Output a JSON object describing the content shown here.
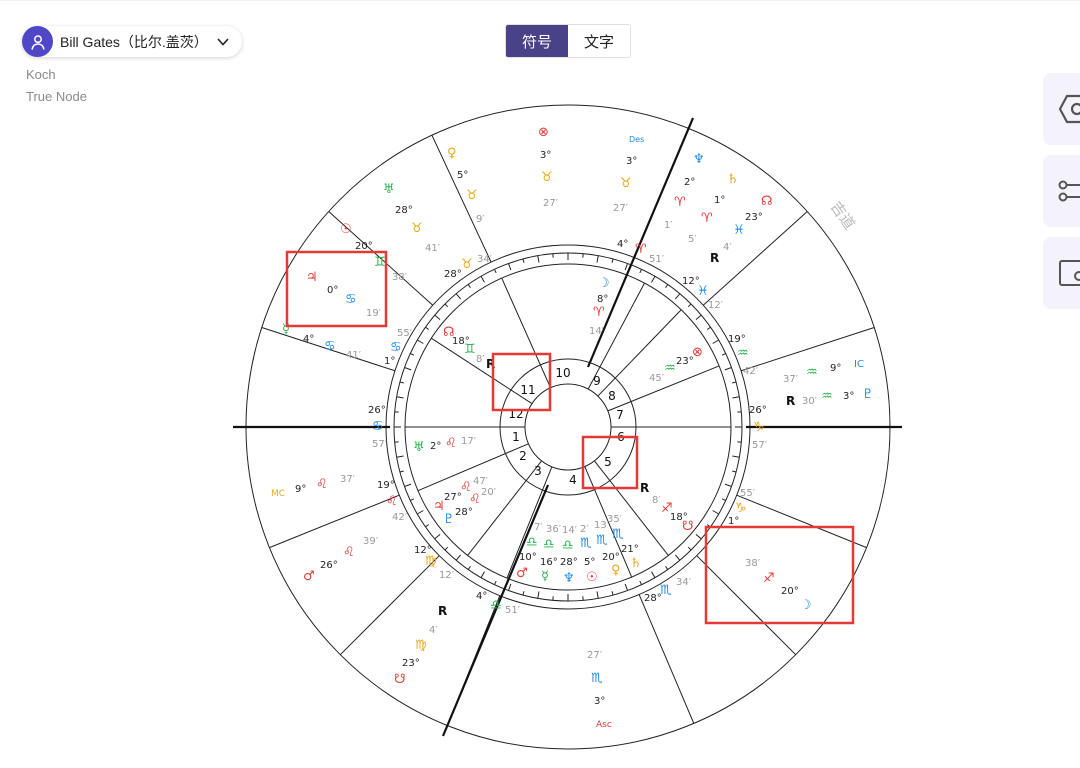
{
  "user": {
    "name": "Bill Gates（比尔.盖茨）"
  },
  "settings": {
    "house_system": "Koch",
    "node_type": "True Node"
  },
  "view_toggle": {
    "symbols_label": "符号",
    "text_label": "文字",
    "active": "symbols"
  },
  "chart": {
    "watermark": "吉道",
    "houses": [
      "1",
      "2",
      "3",
      "4",
      "5",
      "6",
      "7",
      "8",
      "9",
      "10",
      "11",
      "12"
    ],
    "angles": {
      "ic": "IC",
      "mc": "MC",
      "des": "Des",
      "asc": "Asc"
    },
    "retrograde_mark": "R",
    "inner_cusps": [
      {
        "deg": "4°",
        "sign": "♈",
        "min": "51′"
      },
      {
        "deg": "12°",
        "sign": "♓",
        "min": "12′"
      },
      {
        "deg": "19°",
        "sign": "♒",
        "min": "42′"
      },
      {
        "deg": "26°",
        "sign": "♑",
        "min": "57′"
      },
      {
        "deg": "1°",
        "sign": "♑",
        "min": "55′"
      },
      {
        "deg": "28°",
        "sign": "♏",
        "min": "34′"
      },
      {
        "deg": "4°",
        "sign": "♎",
        "min": "51′"
      },
      {
        "deg": "12°",
        "sign": "♍",
        "min": "12′"
      },
      {
        "deg": "19°",
        "sign": "♌",
        "min": "42′"
      },
      {
        "deg": "26°",
        "sign": "♋",
        "min": "57′"
      },
      {
        "deg": "1°",
        "sign": "♋",
        "min": "55′"
      },
      {
        "deg": "28°",
        "sign": "♉",
        "min": "34′"
      }
    ],
    "inner_planets": [
      {
        "name": "moon",
        "glyph": "☽",
        "deg": "8°",
        "sign": "♈",
        "min": "14′"
      },
      {
        "name": "part-of-fortune",
        "glyph": "⊗",
        "deg": "23°",
        "sign": "♒",
        "min": "45′"
      },
      {
        "name": "south-node",
        "glyph": "☋",
        "deg": "18°",
        "sign": "♐",
        "min": "8′",
        "retro": "R"
      },
      {
        "name": "north-node",
        "glyph": "☊",
        "deg": "18°",
        "sign": "♊",
        "min": "8′",
        "retro": "R"
      },
      {
        "name": "uranus",
        "glyph": "♅",
        "deg": "2°",
        "sign": "♌",
        "min": "17′"
      },
      {
        "name": "lilith",
        "glyph": "⚸",
        "deg": "27°",
        "sign": "♌",
        "min": "47′"
      },
      {
        "name": "jupiter",
        "glyph": "♃",
        "deg": "28°",
        "sign": "♌",
        "min": "20′"
      },
      {
        "name": "pluto",
        "glyph": "♇",
        "deg": "28°",
        "sign": "♌",
        "min": "20′"
      },
      {
        "name": "mars",
        "glyph": "♂",
        "deg": "10°",
        "sign": "♎",
        "min": "7′"
      },
      {
        "name": "mercury",
        "glyph": "☿",
        "deg": "16°",
        "sign": "♎",
        "min": "36′"
      },
      {
        "name": "neptune",
        "glyph": "♆",
        "deg": "28°",
        "sign": "♎",
        "min": "14′"
      },
      {
        "name": "sun",
        "glyph": "☉",
        "deg": "5°",
        "sign": "♏",
        "min": "2′"
      },
      {
        "name": "venus",
        "glyph": "♀",
        "deg": "20°",
        "sign": "♏",
        "min": "13′"
      },
      {
        "name": "saturn",
        "glyph": "♄",
        "deg": "21°",
        "sign": "♏",
        "min": "35′"
      }
    ],
    "outer_planets": [
      {
        "name": "transit-part-of-fortune",
        "glyph": "⊗",
        "deg": "3°",
        "sign": "♉",
        "min": "27′"
      },
      {
        "name": "transit-venus",
        "glyph": "♀",
        "deg": "5°",
        "sign": "♉",
        "min": "9′"
      },
      {
        "name": "transit-uranus",
        "glyph": "♅",
        "deg": "28°",
        "sign": "♉",
        "min": "41′"
      },
      {
        "name": "transit-sun",
        "glyph": "☉",
        "deg": "20°",
        "sign": "♊",
        "min": "38′"
      },
      {
        "name": "transit-jupiter",
        "glyph": "♃",
        "deg": "0°",
        "sign": "♋",
        "min": "19′"
      },
      {
        "name": "transit-mercury",
        "glyph": "☿",
        "deg": "4°",
        "sign": "♋",
        "min": "41′"
      },
      {
        "name": "transit-lilith",
        "glyph": "⚸",
        "deg": "9°",
        "sign": "♌",
        "min": "37′"
      },
      {
        "name": "transit-mars",
        "glyph": "♂",
        "deg": "26°",
        "sign": "♌",
        "min": "39′"
      },
      {
        "name": "transit-south-node",
        "glyph": "☋",
        "deg": "23°",
        "sign": "♍",
        "min": "4′",
        "retro": "R"
      },
      {
        "name": "transit-moon",
        "glyph": "☽",
        "deg": "20°",
        "sign": "♐",
        "min": "38′"
      },
      {
        "name": "transit-pluto",
        "glyph": "♇",
        "deg": "3°",
        "sign": "♒",
        "min": "30′",
        "retro": "R"
      },
      {
        "name": "transit-des",
        "deg": "3°",
        "sign": "♉",
        "min": "27′"
      },
      {
        "name": "transit-neptune",
        "glyph": "♆",
        "deg": "2°",
        "sign": "♈",
        "min": "1′"
      },
      {
        "name": "transit-saturn",
        "glyph": "♄",
        "deg": "1°",
        "sign": "♈",
        "min": "5′"
      },
      {
        "name": "transit-north-node",
        "glyph": "☊",
        "deg": "23°",
        "sign": "♓",
        "min": "4′",
        "retro": "R"
      },
      {
        "name": "transit-ic",
        "deg": "9°",
        "sign": "♒",
        "min": "37′"
      },
      {
        "name": "transit-mc",
        "deg": "9°",
        "sign": "♌",
        "min": "37′"
      },
      {
        "name": "transit-asc",
        "deg": "3°",
        "sign": "♏",
        "min": "27′"
      }
    ]
  },
  "colors": {
    "accent": "#4a4288",
    "avatar": "#4f46c8",
    "fire": "#e53935",
    "earth": "#e6a817",
    "air": "#2bb24c",
    "water": "#1e88e5",
    "highlight_box": "#e53935"
  }
}
